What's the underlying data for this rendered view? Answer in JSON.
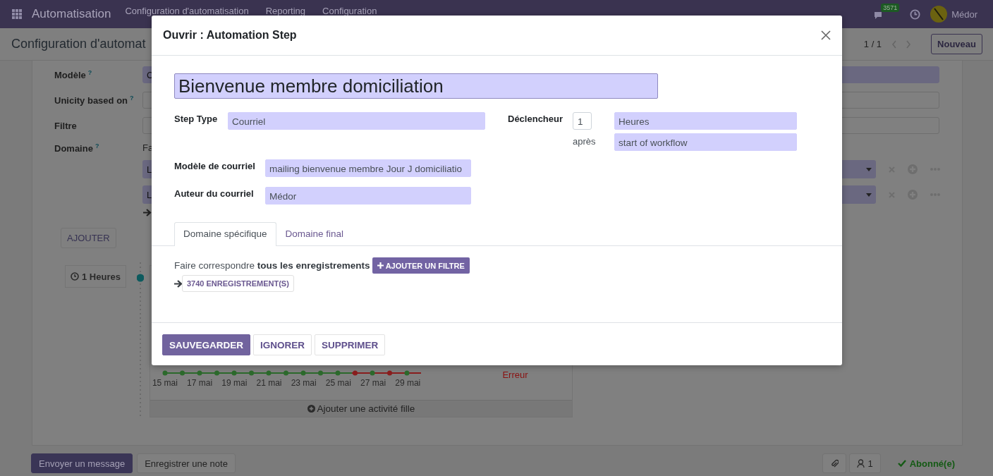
{
  "navbar": {
    "app_name": "Automatisation",
    "menu": [
      "Configuration d'automatisation",
      "Reporting",
      "Configuration"
    ],
    "message_count": "3571",
    "user": "Médor"
  },
  "control_panel": {
    "breadcrumb": "Configuration d'automat",
    "pager": "1 / 1",
    "new_button": "Nouveau"
  },
  "form": {
    "fields": [
      {
        "label": "Modèle",
        "help": "?",
        "value": "C",
        "required": true
      },
      {
        "label": "Unicity based on",
        "help": "?",
        "required": false
      },
      {
        "label": "Filtre",
        "required": false
      }
    ],
    "domain": {
      "label": "Domaine",
      "help": "?",
      "prefix": "Fa",
      "rows": [
        {
          "value": "L"
        },
        {
          "value": "L"
        }
      ]
    },
    "add_button": "AJOUTER",
    "activity": {
      "delay": "1 Heures",
      "dates": [
        "15 mai",
        "17 mai",
        "19 mai",
        "21 mai",
        "23 mai",
        "25 mai",
        "27 mai",
        "29 mai"
      ],
      "status": "Erreur",
      "add_child": "Ajouter une activité fille"
    }
  },
  "chatter": {
    "send_message": "Envoyer un message",
    "log_note": "Enregistrer une note",
    "followers": "1",
    "follow": "Abonné(e)"
  },
  "dialog": {
    "title": "Ouvrir : Automation Step",
    "name": "Bienvenue membre domiciliation",
    "left_fields": [
      {
        "label": "Step Type",
        "value": "Courriel",
        "required": true
      },
      {
        "label": "Modèle de courriel",
        "value": "mailing bienvenue membre Jour J domiciliatio",
        "required": true
      },
      {
        "label": "Auteur du courriel",
        "value": "Médor",
        "required": true
      }
    ],
    "trigger": {
      "label": "Déclencheur",
      "count": "1",
      "unit": "Heures",
      "after_label": "après",
      "reference": "start of workflow"
    },
    "tabs": [
      {
        "label": "Domaine spécifique",
        "selected": true
      },
      {
        "label": "Domaine final",
        "selected": false
      }
    ],
    "domain_text": "Faire correspondre **tous les enregistrements**",
    "add_filter": "AJOUTER UN FILTRE",
    "records": "3740 ENREGISTREMENT(S)",
    "buttons": [
      {
        "label": "SAUVEGARDER",
        "kind": "primary"
      },
      {
        "label": "IGNORER",
        "kind": "secondary"
      },
      {
        "label": "SUPPRIMER",
        "kind": "secondary"
      }
    ]
  }
}
